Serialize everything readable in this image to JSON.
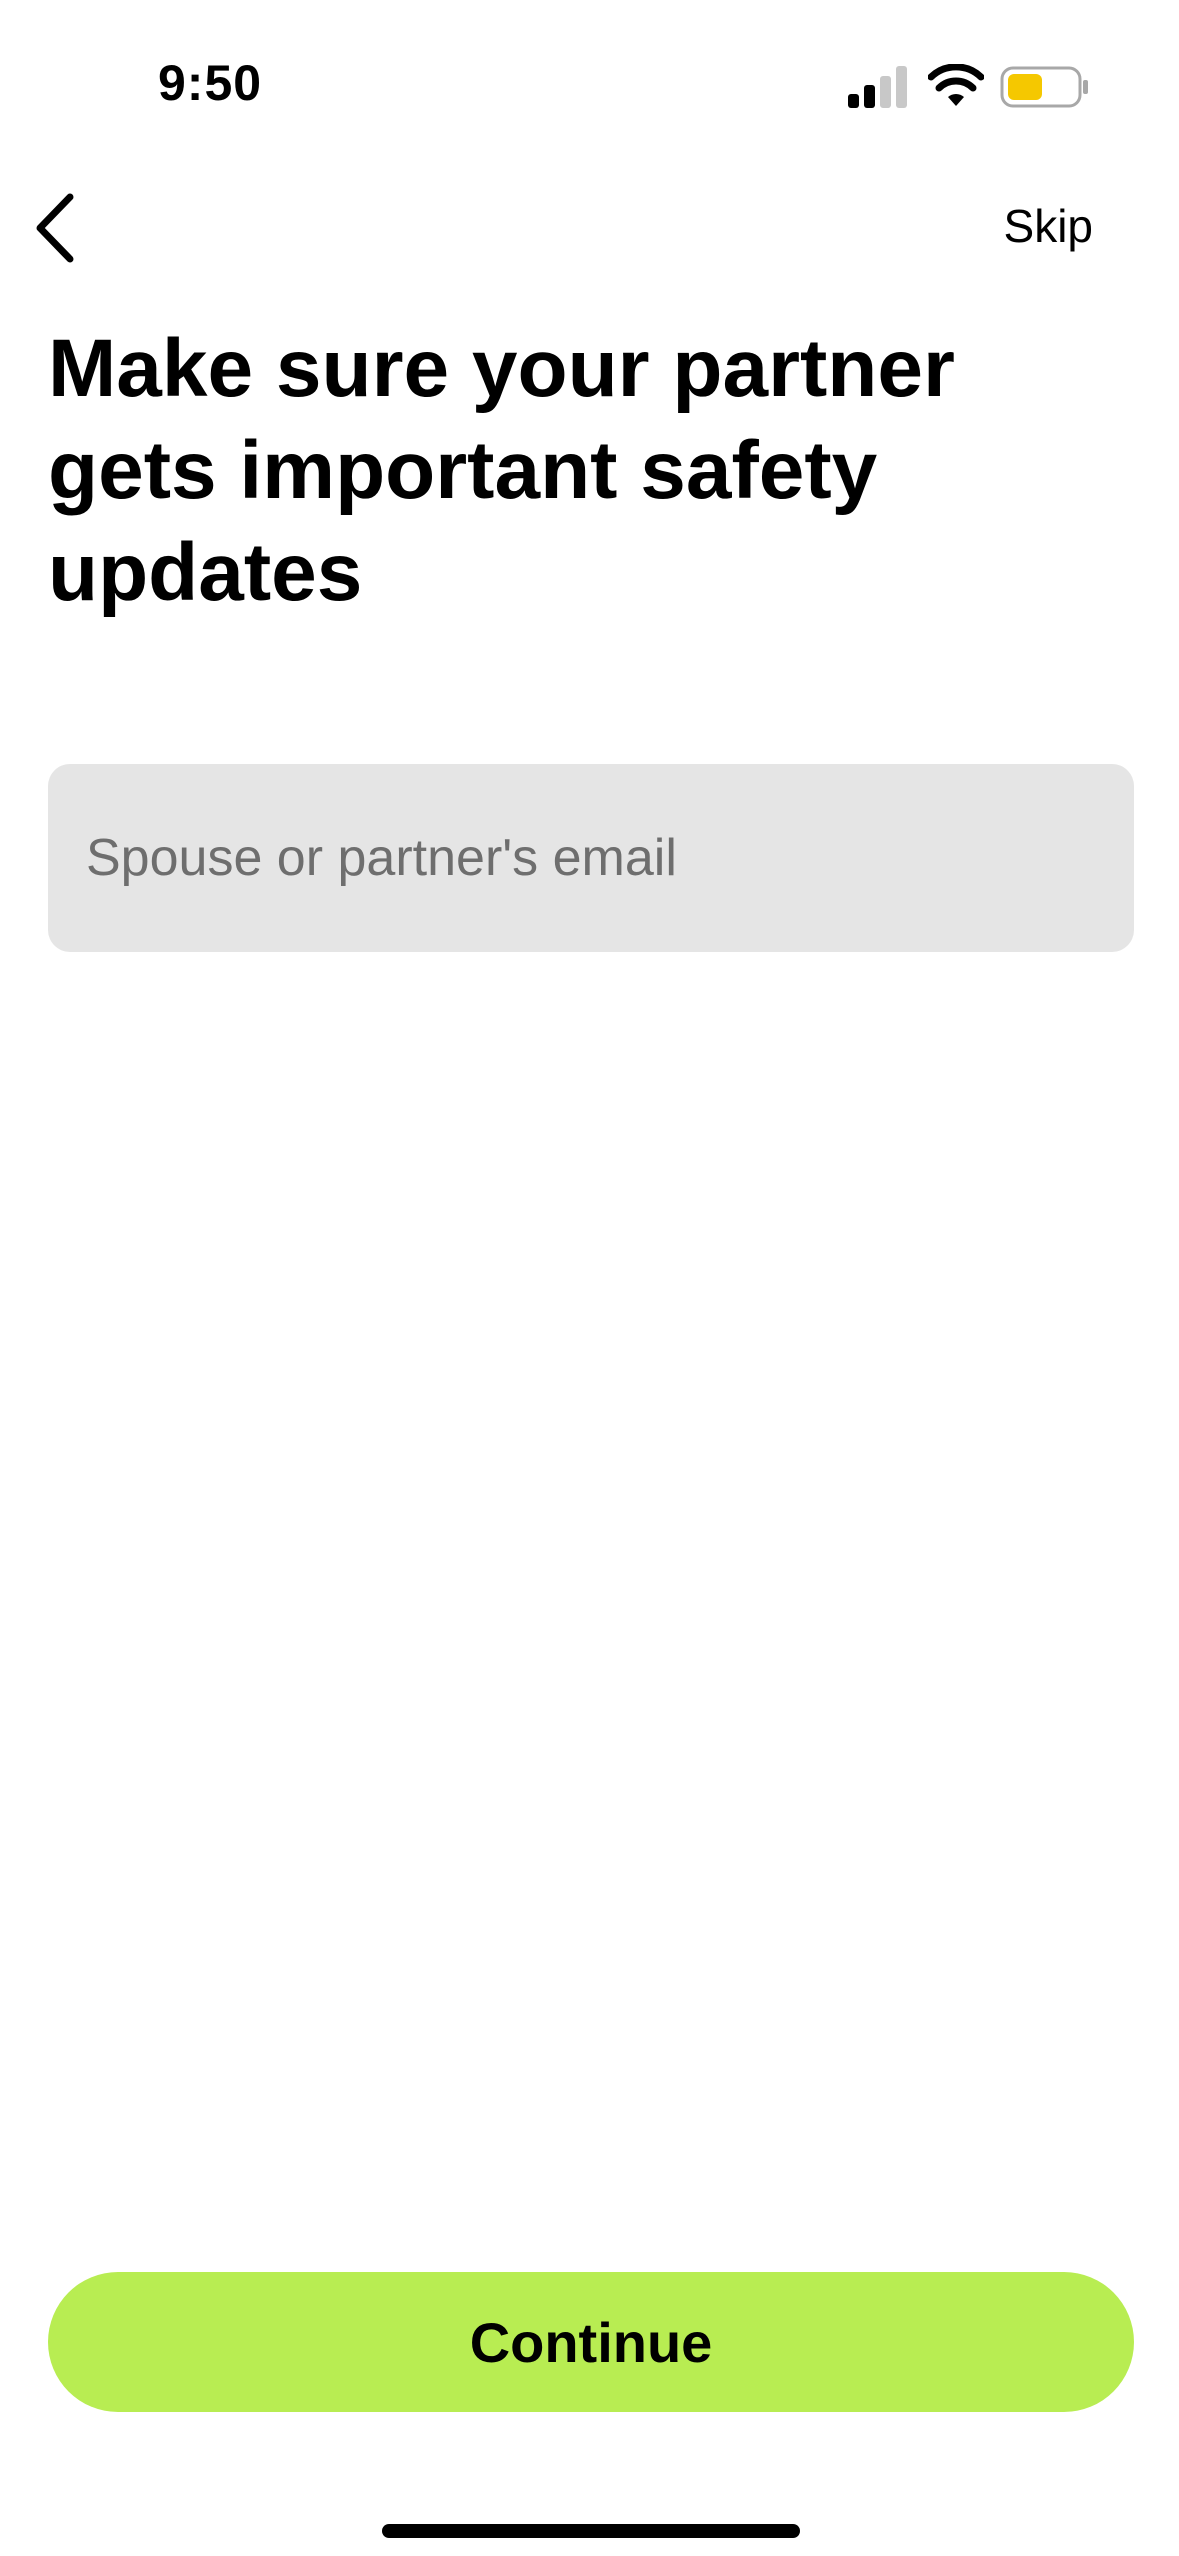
{
  "status_bar": {
    "time": "9:50",
    "icons": [
      "signal-icon",
      "wifi-icon",
      "battery-icon"
    ],
    "battery_color": "#f5c800"
  },
  "nav": {
    "back_icon": "chevron-left-icon",
    "skip_label": "Skip"
  },
  "title": "Make sure your partner gets important safety updates",
  "email_input": {
    "value": "",
    "placeholder": "Spouse or partner's email"
  },
  "continue_label": "Continue",
  "colors": {
    "accent": "#b8ed52",
    "input_background": "#e5e5e5",
    "text": "#000000"
  }
}
